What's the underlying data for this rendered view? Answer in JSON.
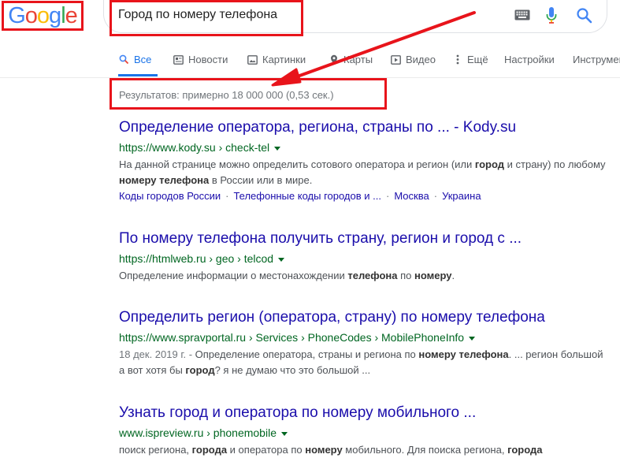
{
  "logo": {
    "letters": [
      "G",
      "o",
      "o",
      "g",
      "l",
      "e"
    ],
    "colors": [
      "#4285f4",
      "#ea4335",
      "#fbbc05",
      "#4285f4",
      "#34a853",
      "#ea4335"
    ]
  },
  "search": {
    "query": "Город по номеру телефона"
  },
  "tabs": [
    {
      "label": "Все",
      "icon": "search-icon",
      "active": true
    },
    {
      "label": "Новости",
      "icon": "news-icon"
    },
    {
      "label": "Картинки",
      "icon": "image-icon"
    },
    {
      "label": "Карты",
      "icon": "map-pin-icon"
    },
    {
      "label": "Видео",
      "icon": "video-icon"
    },
    {
      "label": "Ещё",
      "icon": "more-icon"
    },
    {
      "label": "Настройки"
    },
    {
      "label": "Инструменты"
    }
  ],
  "stats": "Результатов: примерно 18 000 000 (0,53 сек.)",
  "results": [
    {
      "title": "Определение оператора, региона, страны по ... - Kody.su",
      "url": "https://www.kody.su › check-tel",
      "snippet_parts": [
        [
          "На данной странице можно определить сотового оператора и регион (или ",
          false
        ],
        [
          "город",
          true
        ],
        [
          " и страну) по любому ",
          false
        ],
        [
          "номеру телефона",
          true
        ],
        [
          " в России или в мире.",
          false
        ]
      ],
      "sitelinks": [
        "Коды городов России",
        "Телефонные коды городов и ...",
        "Москва",
        "Украина"
      ]
    },
    {
      "title": "По номеру телефона получить страну, регион и город с ...",
      "url": "https://htmlweb.ru › geo › telcod",
      "snippet_parts": [
        [
          "Определение информации о местонахождении ",
          false
        ],
        [
          "телефона",
          true
        ],
        [
          " по ",
          false
        ],
        [
          "номеру",
          true
        ],
        [
          ".",
          false
        ]
      ]
    },
    {
      "title": "Определить регион (оператора, страну) по номеру телефона",
      "url": "https://www.spravportal.ru › Services › PhoneCodes › MobilePhoneInfo",
      "date": "18 дек. 2019 г. - ",
      "snippet_parts": [
        [
          "Определение оператора, страны и региона по ",
          false
        ],
        [
          "номеру телефона",
          true
        ],
        [
          ". ... регион большой а вот хотя бы ",
          false
        ],
        [
          "город",
          true
        ],
        [
          "? я не думаю что это большой ...",
          false
        ]
      ]
    },
    {
      "title": "Узнать город и оператора по номеру мобильного ...",
      "url": "www.ispreview.ru › phonemobile",
      "snippet_parts": [
        [
          "поиск региона, ",
          false
        ],
        [
          "города",
          true
        ],
        [
          " и оператора по ",
          false
        ],
        [
          "номеру",
          true
        ],
        [
          " мобильного. Для поиска региона, ",
          false
        ],
        [
          "города",
          true
        ]
      ]
    }
  ],
  "colors": {
    "annotation_red": "#e8141b",
    "link": "#1a0dab",
    "url_green": "#006621",
    "accent": "#1a73e8"
  }
}
